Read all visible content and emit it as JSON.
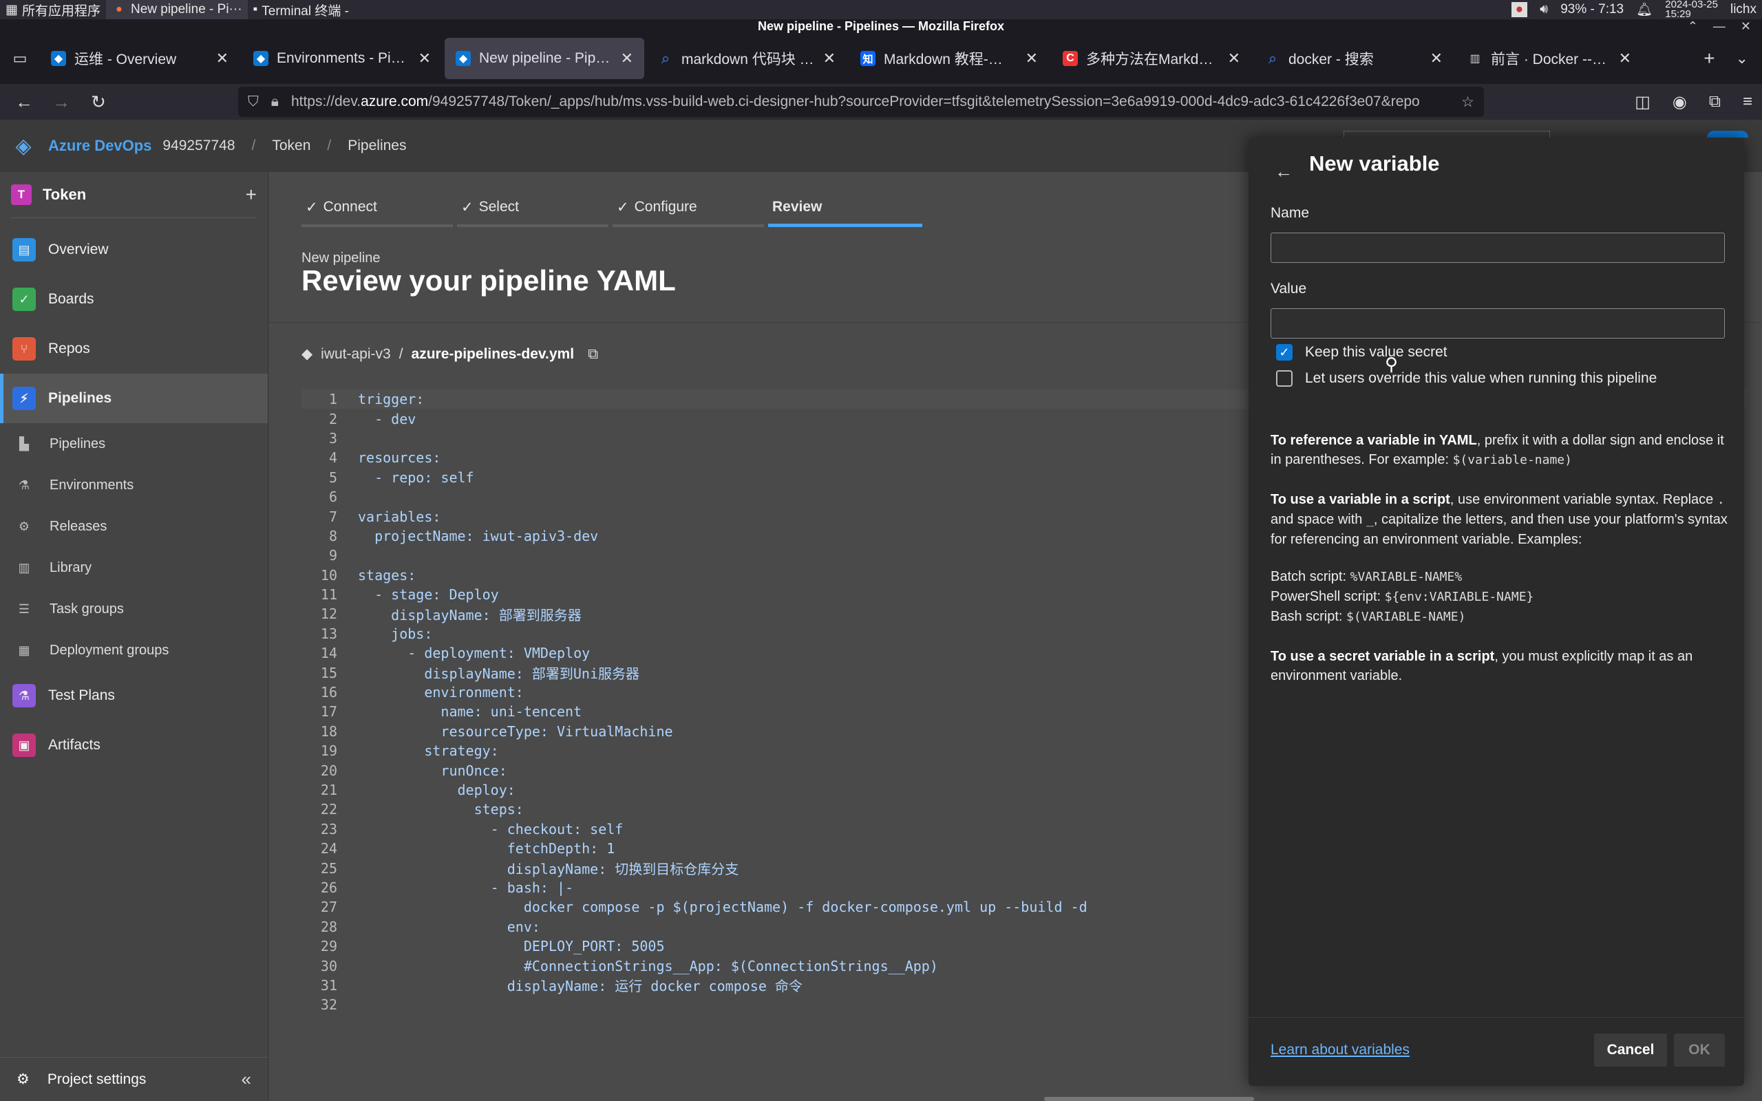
{
  "system": {
    "apps_menu": "所有应用程序",
    "tasks": [
      "New pipeline - Pi···",
      "Terminal 终端 -"
    ],
    "battery": "93% - 7:13",
    "date": "2024-03-25",
    "time": "15:29",
    "user": "lichx"
  },
  "window": {
    "title": "New pipeline - Pipelines — Mozilla Firefox"
  },
  "tabs": [
    {
      "title": "运维 - Overview",
      "fav": "ado"
    },
    {
      "title": "Environments - Pipelines",
      "fav": "ado"
    },
    {
      "title": "New pipeline - Pipelines",
      "fav": "ado"
    },
    {
      "title": "markdown 代码块 - 搜索",
      "fav": "bing"
    },
    {
      "title": "Markdown 教程-引用块",
      "fav": "zhi"
    },
    {
      "title": "多种方法在Markdown加",
      "fav": "csdn"
    },
    {
      "title": "docker - 搜索",
      "fav": "bing"
    },
    {
      "title": "前言 · Docker -- 从入门",
      "fav": "book"
    }
  ],
  "url": {
    "prefix": "https://dev.",
    "domain": "azure.com",
    "rest": "/949257748/Token/_apps/hub/ms.vss-build-web.ci-designer-hub?sourceProvider=tfsgit&telemetrySession=3e6a9919-000d-4dc9-adc3-61c4226f3e07&repo"
  },
  "header": {
    "brand": "Azure DevOps",
    "org": "949257748",
    "project": "Token",
    "section": "Pipelines"
  },
  "sidebar": {
    "project_name": "Token",
    "project_initial": "T",
    "items": [
      {
        "label": "Overview",
        "color": "#2d8fe0"
      },
      {
        "label": "Boards",
        "color": "#3aa757"
      },
      {
        "label": "Repos",
        "color": "#e0583a"
      },
      {
        "label": "Pipelines",
        "color": "#2d6fe0"
      }
    ],
    "sub_items": [
      "Pipelines",
      "Environments",
      "Releases",
      "Library",
      "Task groups",
      "Deployment groups"
    ],
    "items_bottom": [
      {
        "label": "Test Plans",
        "color": "#8c5bd8"
      },
      {
        "label": "Artifacts",
        "color": "#c2357a"
      }
    ],
    "settings": "Project settings"
  },
  "wizard": {
    "steps": [
      "Connect",
      "Select",
      "Configure",
      "Review"
    ],
    "subtitle": "New pipeline",
    "title": "Review your pipeline YAML",
    "repo": "iwut-api-v3",
    "file": "azure-pipelines-dev.yml"
  },
  "yaml_lines": [
    "trigger:",
    "  - dev",
    "",
    "resources:",
    "  - repo: self",
    "",
    "variables:",
    "  projectName: iwut-apiv3-dev",
    "",
    "stages:",
    "  - stage: Deploy",
    "    displayName: 部署到服务器",
    "    jobs:",
    "      - deployment: VMDeploy",
    "        displayName: 部署到Uni服务器",
    "        environment:",
    "          name: uni-tencent",
    "          resourceType: VirtualMachine",
    "        strategy:",
    "          runOnce:",
    "            deploy:",
    "              steps:",
    "                - checkout: self",
    "                  fetchDepth: 1",
    "                  displayName: 切换到目标仓库分支",
    "                - bash: |-",
    "                    docker compose -p $(projectName) -f docker-compose.yml up --build -d",
    "                  env:",
    "                    DEPLOY_PORT: 5005",
    "                    #ConnectionStrings__App: $(ConnectionStrings__App)",
    "                  displayName: 运行 docker compose 命令",
    ""
  ],
  "panel": {
    "title": "New variable",
    "name_label": "Name",
    "name_value": "",
    "value_label": "Value",
    "value_value": "",
    "secret_label": "Keep this value secret",
    "secret_checked": true,
    "override_label": "Let users override this value when running this pipeline",
    "override_checked": false,
    "help1_bold": "To reference a variable in YAML",
    "help1_text": ", prefix it with a dollar sign and enclose it in parentheses. For example: ",
    "help1_code": "$(variable-name)",
    "help2_bold": "To use a variable in a script",
    "help2_text1": ", use environment variable syntax. Replace ",
    "help2_code1": ".",
    "help2_text2": " and space with ",
    "help2_code2": "_",
    "help2_text3": ", capitalize the letters, and then use your platform's syntax for referencing an environment variable. Examples:",
    "ex_batch_label": "Batch script: ",
    "ex_batch_code": "%VARIABLE-NAME%",
    "ex_ps_label": "PowerShell script: ",
    "ex_ps_code": "${env:VARIABLE-NAME}",
    "ex_bash_label": "Bash script: ",
    "ex_bash_code": "$(VARIABLE-NAME)",
    "help3_bold": "To use a secret variable in a script",
    "help3_text": ", you must explicitly map it as an environment variable.",
    "learn": "Learn about variables",
    "cancel": "Cancel",
    "ok": "OK"
  }
}
